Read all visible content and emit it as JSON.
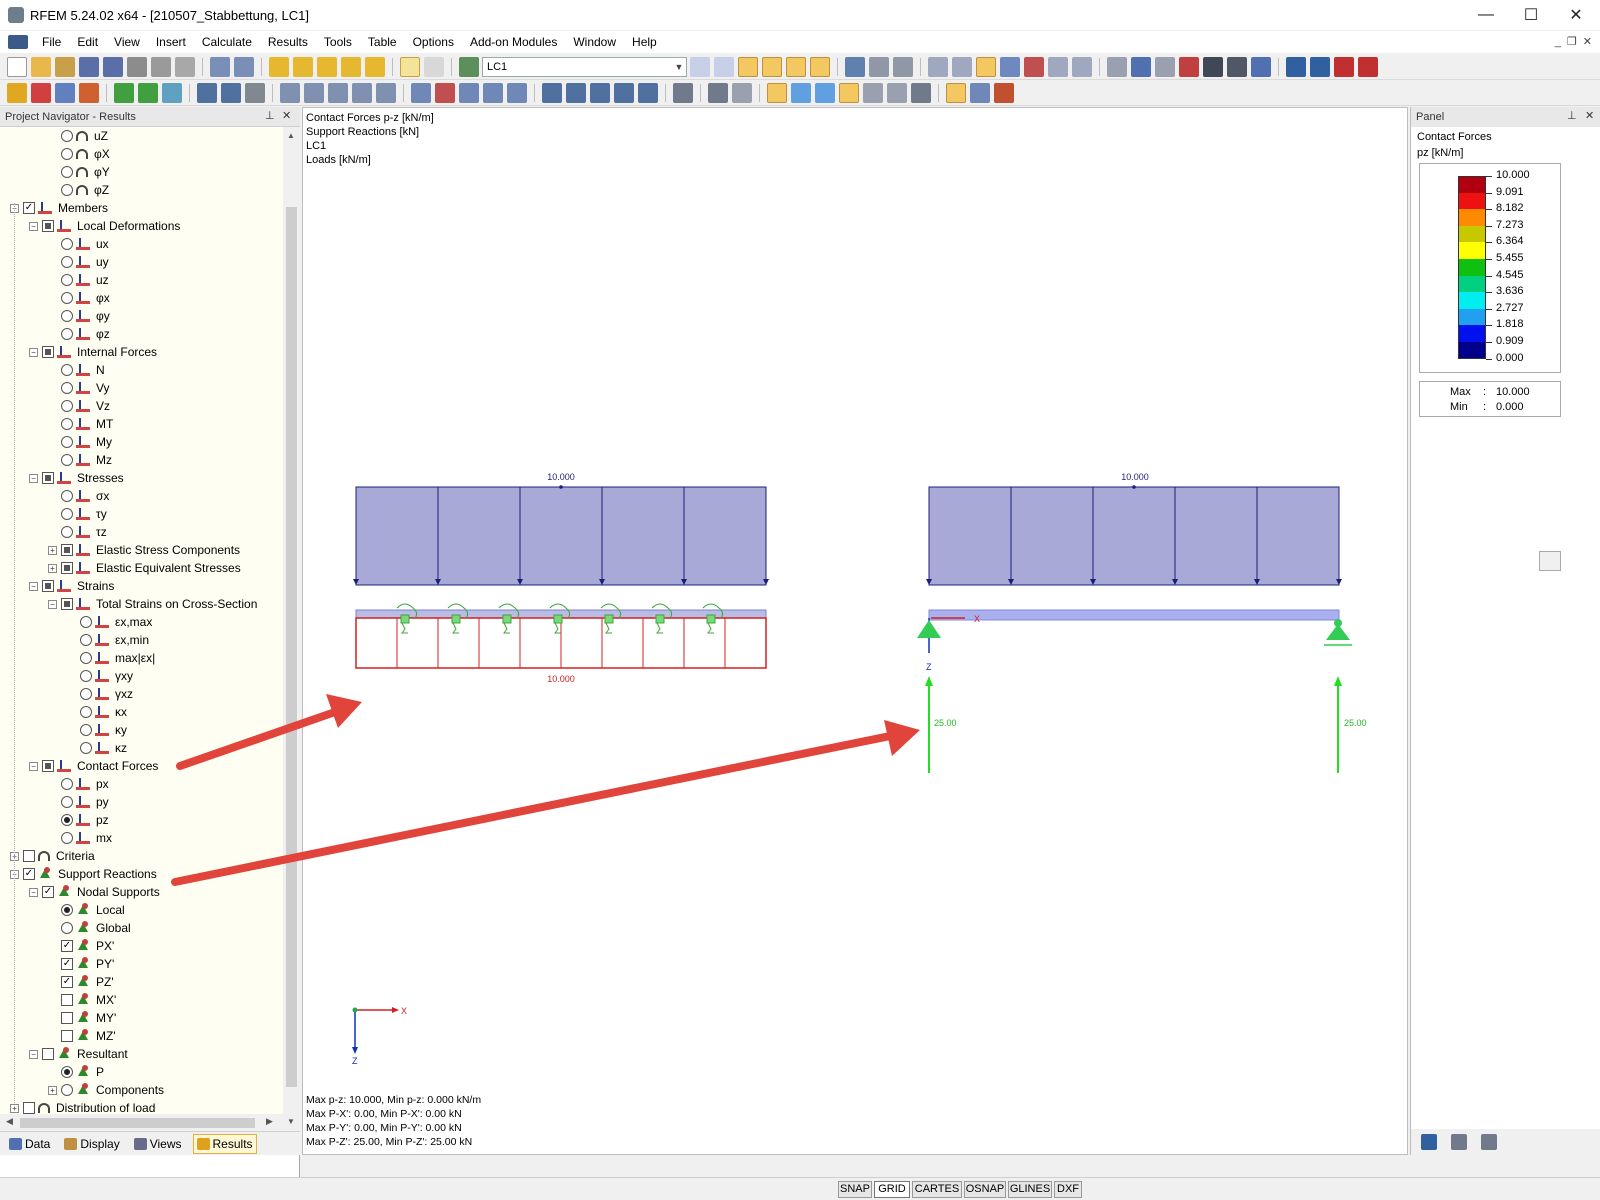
{
  "window": {
    "title": "RFEM 5.24.02 x64 - [210507_Stabbettung, LC1]",
    "controls": [
      "—",
      "☐",
      "✕"
    ]
  },
  "menu": {
    "items": [
      "File",
      "Edit",
      "View",
      "Insert",
      "Calculate",
      "Results",
      "Tools",
      "Table",
      "Options",
      "Add-on Modules",
      "Window",
      "Help"
    ],
    "mdi_controls": [
      "_",
      "❐",
      "✕"
    ]
  },
  "toolbar": {
    "loadcase_value": "LC1"
  },
  "navigator": {
    "title": "Project Navigator - Results",
    "tree": [
      {
        "label": "uZ",
        "level": 2,
        "input": "radio",
        "icon": "arc-icon",
        "toggle": "none"
      },
      {
        "label": "φX",
        "level": 2,
        "input": "radio",
        "icon": "arc-icon",
        "toggle": "none"
      },
      {
        "label": "φY",
        "level": 2,
        "input": "radio",
        "icon": "arc-icon",
        "toggle": "none"
      },
      {
        "label": "φZ",
        "level": 2,
        "input": "radio",
        "icon": "arc-icon",
        "toggle": "none"
      },
      {
        "label": "Members",
        "level": 0,
        "input": "check-full",
        "icon": "member-icon",
        "toggle": "minus"
      },
      {
        "label": "Local Deformations",
        "level": 1,
        "input": "check-part",
        "icon": "member-icon",
        "toggle": "minus"
      },
      {
        "label": "ux",
        "level": 2,
        "input": "radio",
        "icon": "member-icon",
        "toggle": "none"
      },
      {
        "label": "uy",
        "level": 2,
        "input": "radio",
        "icon": "member-icon",
        "toggle": "none"
      },
      {
        "label": "uz",
        "level": 2,
        "input": "radio",
        "icon": "member-icon",
        "toggle": "none"
      },
      {
        "label": "φx",
        "level": 2,
        "input": "radio",
        "icon": "member-icon",
        "toggle": "none"
      },
      {
        "label": "φy",
        "level": 2,
        "input": "radio",
        "icon": "member-icon",
        "toggle": "none"
      },
      {
        "label": "φz",
        "level": 2,
        "input": "radio",
        "icon": "member-icon",
        "toggle": "none"
      },
      {
        "label": "Internal Forces",
        "level": 1,
        "input": "check-part",
        "icon": "member-icon",
        "toggle": "minus"
      },
      {
        "label": "N",
        "level": 2,
        "input": "radio",
        "icon": "member-icon",
        "toggle": "none"
      },
      {
        "label": "Vy",
        "level": 2,
        "input": "radio",
        "icon": "member-icon",
        "toggle": "none"
      },
      {
        "label": "Vz",
        "level": 2,
        "input": "radio",
        "icon": "member-icon",
        "toggle": "none"
      },
      {
        "label": "MT",
        "level": 2,
        "input": "radio",
        "icon": "member-icon",
        "toggle": "none"
      },
      {
        "label": "My",
        "level": 2,
        "input": "radio",
        "icon": "member-icon",
        "toggle": "none"
      },
      {
        "label": "Mz",
        "level": 2,
        "input": "radio",
        "icon": "member-icon",
        "toggle": "none"
      },
      {
        "label": "Stresses",
        "level": 1,
        "input": "check-part",
        "icon": "member-icon",
        "toggle": "minus"
      },
      {
        "label": "σx",
        "level": 2,
        "input": "radio",
        "icon": "member-icon",
        "toggle": "none"
      },
      {
        "label": "τy",
        "level": 2,
        "input": "radio",
        "icon": "member-icon",
        "toggle": "none"
      },
      {
        "label": "τz",
        "level": 2,
        "input": "radio",
        "icon": "member-icon",
        "toggle": "none"
      },
      {
        "label": "Elastic Stress Components",
        "level": 2,
        "input": "check-part",
        "icon": "member-icon",
        "toggle": "plus"
      },
      {
        "label": "Elastic Equivalent Stresses",
        "level": 2,
        "input": "check-part",
        "icon": "member-icon",
        "toggle": "plus"
      },
      {
        "label": "Strains",
        "level": 1,
        "input": "check-part",
        "icon": "member-icon",
        "toggle": "minus"
      },
      {
        "label": "Total Strains on Cross-Section",
        "level": 2,
        "input": "check-part",
        "icon": "member-icon",
        "toggle": "minus"
      },
      {
        "label": "εx,max",
        "level": 3,
        "input": "radio",
        "icon": "member-icon",
        "toggle": "none"
      },
      {
        "label": "εx,min",
        "level": 3,
        "input": "radio",
        "icon": "member-icon",
        "toggle": "none"
      },
      {
        "label": "max|εx|",
        "level": 3,
        "input": "radio",
        "icon": "member-icon",
        "toggle": "none"
      },
      {
        "label": "γxy",
        "level": 3,
        "input": "radio",
        "icon": "member-icon",
        "toggle": "none"
      },
      {
        "label": "γxz",
        "level": 3,
        "input": "radio",
        "icon": "member-icon",
        "toggle": "none"
      },
      {
        "label": "κx",
        "level": 3,
        "input": "radio",
        "icon": "member-icon",
        "toggle": "none"
      },
      {
        "label": "κy",
        "level": 3,
        "input": "radio",
        "icon": "member-icon",
        "toggle": "none"
      },
      {
        "label": "κz",
        "level": 3,
        "input": "radio",
        "icon": "member-icon",
        "toggle": "none"
      },
      {
        "label": "Contact Forces",
        "level": 1,
        "input": "check-part",
        "icon": "member-icon",
        "toggle": "minus"
      },
      {
        "label": "px",
        "level": 2,
        "input": "radio",
        "icon": "member-icon",
        "toggle": "none"
      },
      {
        "label": "py",
        "level": 2,
        "input": "radio",
        "icon": "member-icon",
        "toggle": "none"
      },
      {
        "label": "pz",
        "level": 2,
        "input": "radio-on",
        "icon": "member-icon",
        "toggle": "none"
      },
      {
        "label": "mx",
        "level": 2,
        "input": "radio",
        "icon": "member-icon",
        "toggle": "none"
      },
      {
        "label": "Criteria",
        "level": 0,
        "input": "check-empty",
        "icon": "arc-icon",
        "toggle": "plus"
      },
      {
        "label": "Support Reactions",
        "level": 0,
        "input": "check-full",
        "icon": "support-icon",
        "toggle": "minus"
      },
      {
        "label": "Nodal Supports",
        "level": 1,
        "input": "check-full",
        "icon": "support-icon",
        "toggle": "minus"
      },
      {
        "label": "Local",
        "level": 2,
        "input": "radio-on",
        "icon": "support-icon",
        "toggle": "none"
      },
      {
        "label": "Global",
        "level": 2,
        "input": "radio",
        "icon": "support-icon",
        "toggle": "none"
      },
      {
        "label": "PX'",
        "level": 2,
        "input": "check-full",
        "icon": "support-icon",
        "toggle": "none"
      },
      {
        "label": "PY'",
        "level": 2,
        "input": "check-full",
        "icon": "support-icon",
        "toggle": "none"
      },
      {
        "label": "PZ'",
        "level": 2,
        "input": "check-full",
        "icon": "support-icon",
        "toggle": "none"
      },
      {
        "label": "MX'",
        "level": 2,
        "input": "check-empty",
        "icon": "support-icon",
        "toggle": "none"
      },
      {
        "label": "MY'",
        "level": 2,
        "input": "check-empty",
        "icon": "support-icon",
        "toggle": "none"
      },
      {
        "label": "MZ'",
        "level": 2,
        "input": "check-empty",
        "icon": "support-icon",
        "toggle": "none"
      },
      {
        "label": "Resultant",
        "level": 1,
        "input": "check-empty",
        "icon": "support-icon",
        "toggle": "minus"
      },
      {
        "label": "P",
        "level": 2,
        "input": "radio-on",
        "icon": "support-icon",
        "toggle": "none"
      },
      {
        "label": "Components",
        "level": 2,
        "input": "radio",
        "icon": "support-icon",
        "toggle": "plus"
      },
      {
        "label": "Distribution of load",
        "level": 0,
        "input": "check-empty",
        "icon": "arc-icon",
        "toggle": "plus"
      }
    ],
    "tabs": [
      {
        "label": "Data",
        "icon": "data-icon",
        "active": false
      },
      {
        "label": "Display",
        "icon": "display-icon",
        "active": false
      },
      {
        "label": "Views",
        "icon": "views-icon",
        "active": false
      },
      {
        "label": "Results",
        "icon": "results-icon",
        "active": true
      }
    ]
  },
  "graphics": {
    "header_lines": [
      "Contact Forces p-z [kN/m]",
      "Support Reactions [kN]",
      "LC1",
      "Loads [kN/m]"
    ],
    "left_model": {
      "load_value": "10.000",
      "contact_value": "10.000"
    },
    "right_model": {
      "load_value": "10.000",
      "reaction_left": "25.00",
      "reaction_right": "25.00",
      "axis_x": "X",
      "axis_z": "Z"
    },
    "coord_axes": {
      "x": "X",
      "z": "Z"
    },
    "footer_lines": [
      "Max p-z: 10.000, Min p-z: 0.000 kN/m",
      "Max P-X': 0.00, Min P-X': 0.00 kN",
      "Max P-Y': 0.00, Min P-Y': 0.00 kN",
      "Max P-Z': 25.00, Min P-Z': 25.00 kN"
    ],
    "colors": {
      "load_fill": "#a8a9d6",
      "load_line": "#1c1f7a",
      "contact": "#d42020",
      "reaction": "#22dd22",
      "support": "#33cc55",
      "arrow": "#e0443a"
    }
  },
  "panel": {
    "title": "Panel",
    "heading": "Contact Forces",
    "unit": "pz [kN/m]",
    "legend_values": [
      "10.000",
      "9.091",
      "8.182",
      "7.273",
      "6.364",
      "5.455",
      "4.545",
      "3.636",
      "2.727",
      "1.818",
      "0.909",
      "0.000"
    ],
    "legend_colors": [
      "#b00010",
      "#ee1111",
      "#ff8a00",
      "#c8c800",
      "#ffff00",
      "#10c010",
      "#00d080",
      "#00eeee",
      "#20a0ee",
      "#0010ee",
      "#00008a"
    ],
    "max_label": "Max",
    "max_value": "10.000",
    "min_label": "Min",
    "min_value": "0.000"
  },
  "statusbar": {
    "buttons": [
      {
        "label": "SNAP",
        "on": false
      },
      {
        "label": "GRID",
        "on": true
      },
      {
        "label": "CARTES",
        "on": false
      },
      {
        "label": "OSNAP",
        "on": false
      },
      {
        "label": "GLINES",
        "on": false
      },
      {
        "label": "DXF",
        "on": false
      }
    ]
  }
}
